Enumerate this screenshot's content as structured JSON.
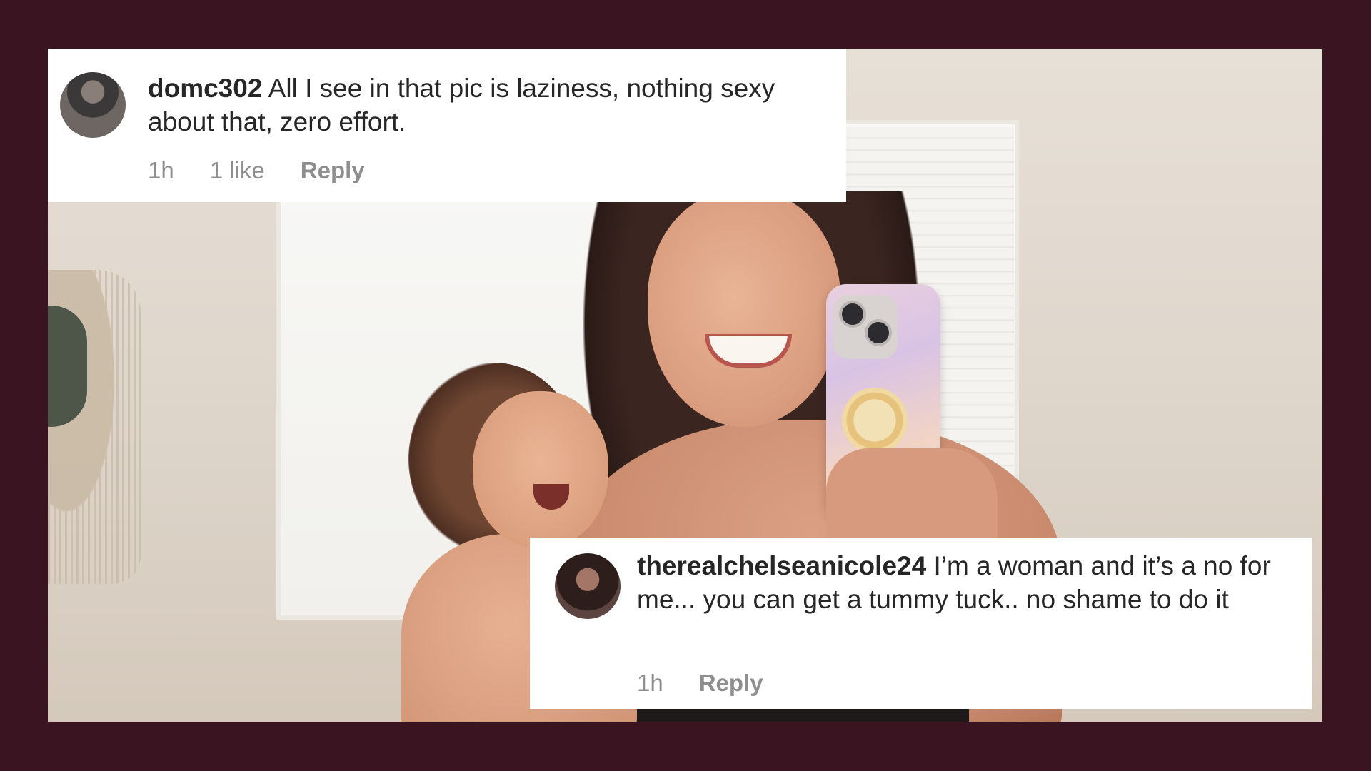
{
  "comments": [
    {
      "username": "domc302",
      "text": "All I see in that pic is laziness, nothing sexy about that, zero effort.",
      "time": "1h",
      "likes": "1 like",
      "reply_label": "Reply"
    },
    {
      "username": "therealchelseanicole24",
      "text": "I’m a woman and it’s a no for me... you can get a tummy tuck.. no shame to do it",
      "time": "1h",
      "reply_label": "Reply"
    }
  ],
  "colors": {
    "background": "#3b1421",
    "card": "#ffffff",
    "username": "#262626",
    "meta": "#8e8e8e"
  }
}
